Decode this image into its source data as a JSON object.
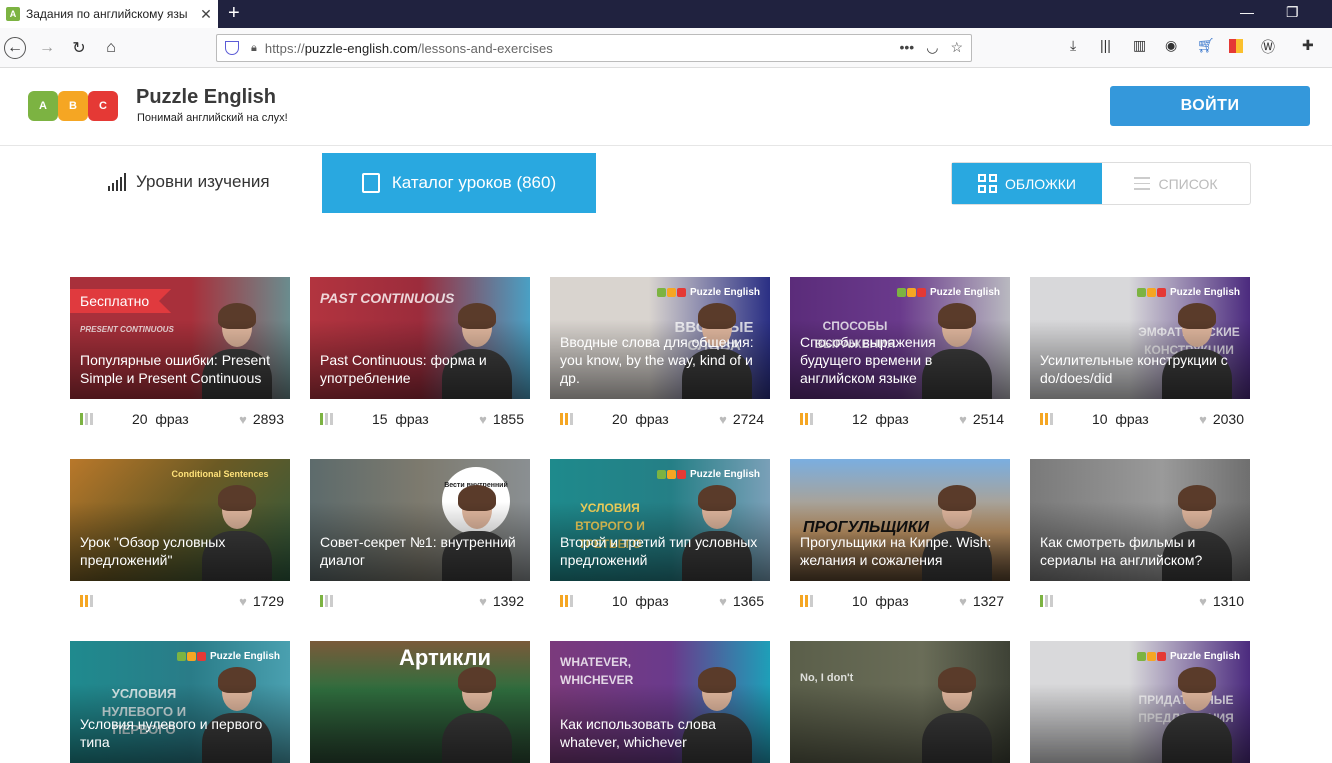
{
  "browser": {
    "tab_title": "Задания по английскому язы",
    "tab_favicon": "A",
    "new_tab": "+",
    "url_prefix": "https://",
    "url_host": "puzzle-english.com",
    "url_path": "/lessons-and-exercises"
  },
  "site": {
    "brand": "Puzzle English",
    "tagline": "Понимай английский на слух!",
    "logo_letters": [
      "A",
      "B",
      "C"
    ],
    "login": "ВОЙТИ"
  },
  "nav": {
    "levels": "Уровни изучения",
    "catalog": "Каталог уроков (860)",
    "view_covers": "ОБЛОЖКИ",
    "view_list": "СПИСОК"
  },
  "phrases_word": "фраз",
  "colors": {
    "accent": "#29a8e0",
    "login": "#3498db",
    "free": "#e03a3e",
    "lvl_green": "#7cb342",
    "lvl_orange": "#f5a623"
  },
  "cards": [
    {
      "title": "Популярные ошибки: Present Simple и Present Continuous",
      "badge": "Бесплатно",
      "phrases": "20",
      "likes": "2893",
      "level": "green",
      "deco": "PRESENT CONTINUOUS"
    },
    {
      "title": "Past Continuous: форма и употребление",
      "phrases": "15",
      "likes": "1855",
      "level": "green",
      "deco": "PAST CONTINUOUS"
    },
    {
      "title": "Вводные слова для общения: you know, by the way, kind of и др.",
      "phrases": "20",
      "likes": "2724",
      "level": "orange",
      "deco": "ВВОДНЫЕ СЛОВА",
      "brand": "Puzzle English"
    },
    {
      "title": "Способы выражения будущего времени в английском языке",
      "phrases": "12",
      "likes": "2514",
      "level": "orange",
      "deco": "СПОСОБЫ ВЫРАЖЕНИЯ",
      "brand": "Puzzle English"
    },
    {
      "title": "Усилительные конструкции с do/does/did",
      "phrases": "10",
      "likes": "2030",
      "level": "orange",
      "deco": "ЭМФАТИЧЕСКИЕ КОНСТРУКЦИИ",
      "brand": "Puzzle English"
    },
    {
      "title": "Урок \"Обзор условных предложений\"",
      "phrases": "",
      "likes": "1729",
      "level": "orange",
      "deco": "Conditional Sentences"
    },
    {
      "title": "Совет-секрет №1: внутренний диалог",
      "phrases": "",
      "likes": "1392",
      "level": "green",
      "deco": "Вести внутренний диалог"
    },
    {
      "title": "Второй и третий тип условных предложений",
      "phrases": "10",
      "likes": "1365",
      "level": "orange",
      "deco": "УСЛОВИЯ ВТОРОГО И ТРЕТЬЕГО",
      "brand": "Puzzle English"
    },
    {
      "title": "Прогульщики на Кипре. Wish: желания и сожаления",
      "phrases": "10",
      "likes": "1327",
      "level": "orange",
      "deco": "ПРОГУЛЬЩИКИ"
    },
    {
      "title": "Как смотреть фильмы и сериалы на английском?",
      "phrases": "",
      "likes": "1310",
      "level": "green",
      "deco": ""
    },
    {
      "title": "Условия нулевого и первого типа",
      "deco": "УСЛОВИЯ НУЛЕВОГО И ПЕРВОГО",
      "brand": "Puzzle English"
    },
    {
      "title": "",
      "deco": "Артикли"
    },
    {
      "title": "Как использовать слова whatever, whichever",
      "deco": "WHATEVER, WHICHEVER"
    },
    {
      "title": "",
      "deco": "No, I don't"
    },
    {
      "title": "",
      "deco": "ПРИДАТОЧНЫЕ ПРЕДЛОЖЕНИЯ",
      "brand": "Puzzle English"
    }
  ]
}
